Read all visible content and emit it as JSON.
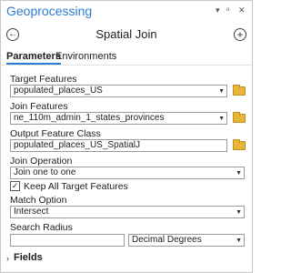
{
  "pane": {
    "title": "Geoprocessing",
    "controls": [
      "▾",
      "ᵒ",
      "✕"
    ]
  },
  "header": {
    "back_icon": "←",
    "tool_title": "Spatial Join",
    "add_icon": "+"
  },
  "tabs": [
    {
      "label": "Parameters",
      "active": true
    },
    {
      "label": "Environments",
      "active": false
    }
  ],
  "params": {
    "target_features": {
      "label": "Target Features",
      "value": "populated_places_US"
    },
    "join_features": {
      "label": "Join Features",
      "value": "ne_110m_admin_1_states_provinces"
    },
    "output_feature_class": {
      "label": "Output Feature Class",
      "value": "populated_places_US_SpatialJ"
    },
    "join_operation": {
      "label": "Join Operation",
      "value": "Join one to one"
    },
    "keep_all": {
      "label": "Keep All Target Features",
      "checked": true,
      "mark": "✓"
    },
    "match_option": {
      "label": "Match Option",
      "value": "Intersect"
    },
    "search_radius": {
      "label": "Search Radius",
      "value": "",
      "unit": "Decimal Degrees"
    }
  },
  "fields_section": {
    "label": "Fields",
    "caret": "›"
  },
  "dropdown_caret": "▼",
  "colors": {
    "accent": "#2b7cd3",
    "folder": "#e7b53b"
  }
}
